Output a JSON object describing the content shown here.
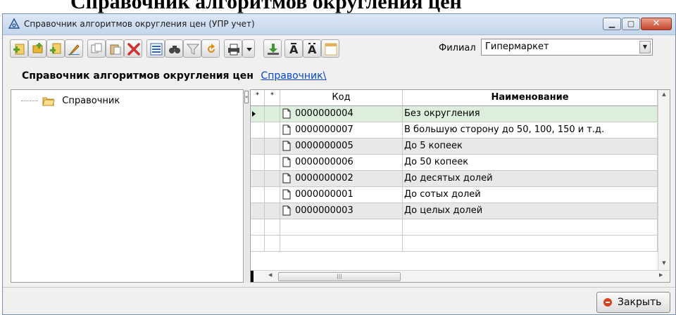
{
  "heading": "Справочник алгоритмов округления цен",
  "window": {
    "title": "Справочник алгоритмов округления цен (УПР учет)"
  },
  "toolbar": {
    "branch_label": "Филиал",
    "branch_value": "Гипермаркет",
    "buttons": [
      {
        "name": "add-button",
        "icon": "add-green-icon",
        "color": "#5aa02c"
      },
      {
        "name": "add-group-button",
        "icon": "add-group-icon",
        "color": "#e5b734"
      },
      {
        "name": "add-copy-button",
        "icon": "add-copy-icon",
        "color": "#5aa02c"
      },
      {
        "name": "edit-button",
        "icon": "pencil-icon",
        "color": "#e8a521"
      },
      {
        "name": "copy-button",
        "icon": "copy-icon",
        "color": "#8a8a8a"
      },
      {
        "name": "paste-button",
        "icon": "paste-icon",
        "color": "#8a8a8a"
      },
      {
        "name": "delete-button",
        "icon": "red-x-icon",
        "color": "#d32f2f"
      },
      {
        "name": "properties-button",
        "icon": "list-icon",
        "color": "#2f64c4"
      },
      {
        "name": "find-button",
        "icon": "binoculars-icon",
        "color": "#444444"
      },
      {
        "name": "filter-button",
        "icon": "funnel-icon",
        "color": "#8a8a8a"
      },
      {
        "name": "refresh-button",
        "icon": "refresh-icon",
        "color": "#e08a12"
      },
      {
        "name": "print-button",
        "icon": "printer-icon",
        "color": "#444444"
      },
      {
        "name": "print-dropdown-button",
        "icon": "dropdown-arrow-icon",
        "color": "#222222"
      },
      {
        "name": "import-button",
        "icon": "download-green-icon",
        "color": "#3a9a2c"
      },
      {
        "name": "font-increase-button",
        "icon": "font-a-icon",
        "color": "#222222"
      },
      {
        "name": "font-decrease-button",
        "icon": "font-a-small-icon",
        "color": "#222222"
      },
      {
        "name": "layout-button",
        "icon": "table-layout-icon",
        "color": "#e2b25c"
      }
    ]
  },
  "header": {
    "title": "Справочник алгоритмов округления цен",
    "link": "Справочник\\"
  },
  "tree": {
    "root_label": "Справочник"
  },
  "grid": {
    "columns": {
      "star1": "*",
      "star2": "*",
      "code": "Код",
      "name": "Наименование"
    },
    "rows": [
      {
        "code": "0000000004",
        "name": "Без округления"
      },
      {
        "code": "0000000007",
        "name": "В большую сторону до 50, 100, 150 и т.д."
      },
      {
        "code": "0000000005",
        "name": "До 5 копеек"
      },
      {
        "code": "0000000006",
        "name": "До 50 копеек"
      },
      {
        "code": "0000000002",
        "name": "До десятых долей"
      },
      {
        "code": "0000000001",
        "name": "До сотых долей"
      },
      {
        "code": "0000000003",
        "name": "До целых долей"
      },
      {
        "code": "",
        "name": ""
      },
      {
        "code": "",
        "name": ""
      }
    ]
  },
  "close_button": {
    "label": "Закрыть"
  },
  "colors": {
    "accent": "#0645c8",
    "selected_row": "#dcefdc",
    "close_icon": "#d7421c"
  }
}
